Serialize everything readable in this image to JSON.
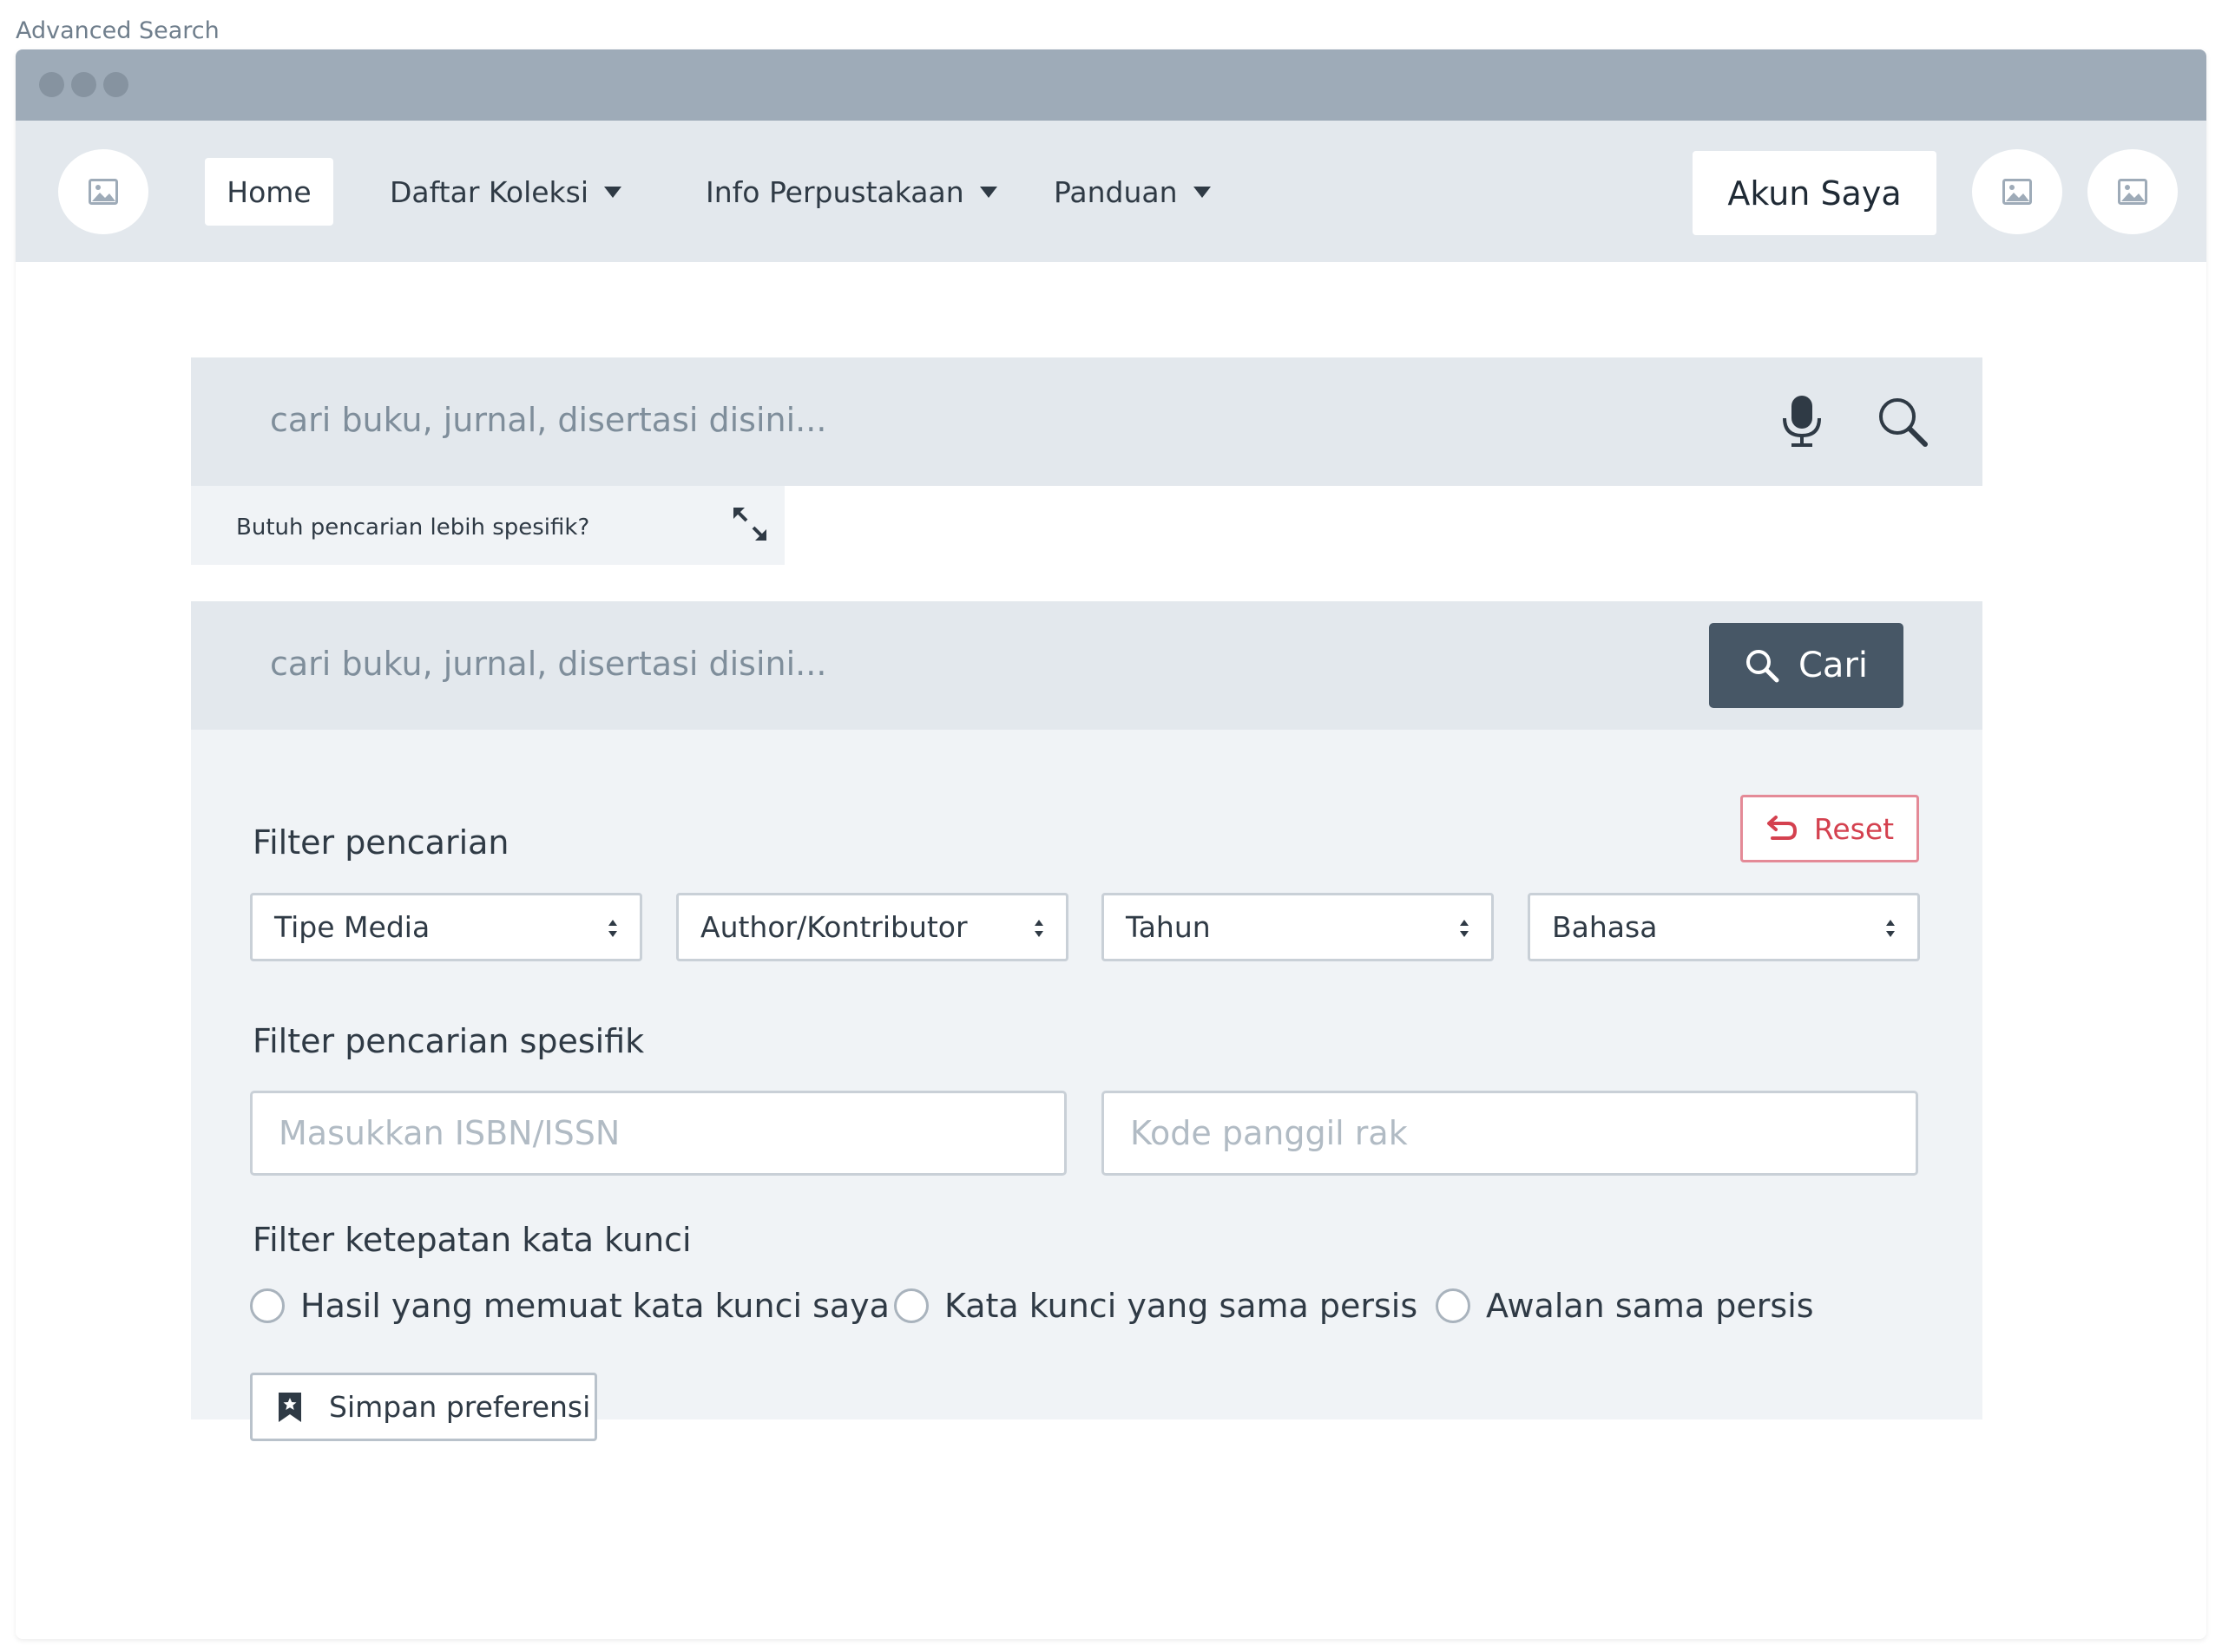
{
  "page": {
    "label": "Advanced Search"
  },
  "navbar": {
    "home": "Home",
    "items": [
      {
        "label": "Daftar Koleksi",
        "icon": "caret-down-icon"
      },
      {
        "label": "Info Perpustakaan",
        "icon": "caret-down-icon"
      },
      {
        "label": "Panduan",
        "icon": "caret-down-icon"
      }
    ],
    "account": "Akun Saya",
    "icons": [
      "image-placeholder-icon",
      "image-placeholder-icon",
      "image-placeholder-icon"
    ]
  },
  "search": {
    "placeholder": "cari buku, jurnal, disertasi disini...",
    "hint": "Butuh pencarian lebih spesifik?",
    "icons": [
      "microphone-icon",
      "search-icon",
      "expand-icon"
    ]
  },
  "advanced": {
    "placeholder": "cari buku, jurnal, disertasi disini...",
    "search_button": "Cari",
    "reset_button": "Reset",
    "filter_title": "Filter pencarian",
    "selects": [
      "Tipe Media",
      "Author/Kontributor",
      "Tahun",
      "Bahasa"
    ],
    "specific_title": "Filter pencarian spesifik",
    "isbn_placeholder": "Masukkan ISBN/ISSN",
    "shelf_placeholder": "Kode panggil rak",
    "keyword_title": "Filter ketepatan kata kunci",
    "radios": [
      "Hasil yang memuat kata kunci saya",
      "Kata kunci yang sama persis",
      "Awalan sama persis"
    ],
    "save_button": "Simpan preferensi"
  },
  "colors": {
    "titlebar": "#9eabb8",
    "navbar": "#e3e8ed",
    "primary_button": "#475766",
    "reset": "#d4414f"
  }
}
